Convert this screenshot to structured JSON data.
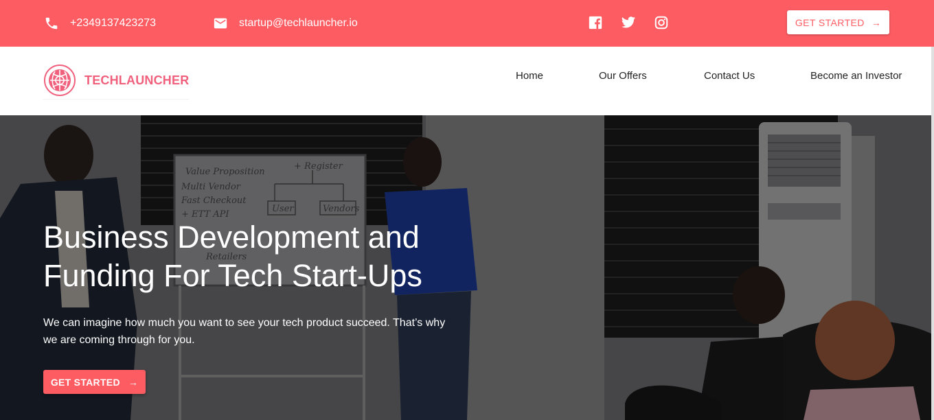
{
  "topbar": {
    "phone": "+2349137423273",
    "email": "startup@techlauncher.io",
    "socials": [
      "facebook-icon",
      "twitter-icon",
      "instagram-icon"
    ],
    "cta": "GET STARTED",
    "cta_arrow": "→",
    "bg_color": "#fd5c63"
  },
  "brand": {
    "name": "TECHLAUNCHER",
    "color": "#f0607d"
  },
  "nav": {
    "items": [
      "Home",
      "Our Offers",
      "Contact Us",
      "Become an Investor"
    ]
  },
  "hero": {
    "title": "Business Development and Funding For Tech Start-Ups",
    "subtitle": "We can imagine how much you want to see your tech product succeed. That’s why we are coming through for you.",
    "cta": "GET STARTED",
    "cta_arrow": "→",
    "whiteboard_lines": [
      "Value Proposition",
      "+ Register",
      "Multi Vendor",
      "Fast Checkout",
      "+ ETT API",
      "User",
      "Vendors",
      "Retailers"
    ]
  }
}
